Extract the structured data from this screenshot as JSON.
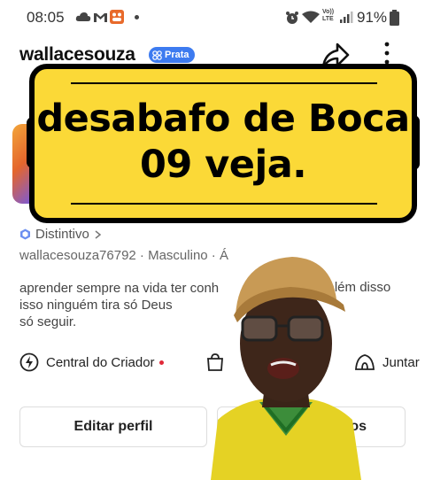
{
  "status_bar": {
    "time": "08:05",
    "battery": "91%",
    "left_icons": [
      "cloud-icon",
      "gmail-icon",
      "app-icon",
      "notification-dot"
    ],
    "right_icons": [
      "alarm-icon",
      "wifi-icon",
      "volte-icon",
      "signal-icon",
      "battery-icon"
    ]
  },
  "profile": {
    "username": "wallacesouza",
    "badge": "Prata",
    "distintivo": "Distintivo",
    "meta": "wallacesouza76792 · Masculino · Á",
    "bio": [
      "aprender sempre na vida ter conh",
      "isso ninguém tira só Deus",
      "só seguir."
    ],
    "bio_tail": "a além disso"
  },
  "overlay": {
    "line1": "desabafo de Boca",
    "line2": "09 veja.",
    "bg_color": "#fbd937"
  },
  "actions": {
    "creator_center": "Central do Criador",
    "shop_partial": "",
    "join_partial": "Juntar"
  },
  "buttons": {
    "edit_profile": "Editar perfil",
    "friends_partial": "igos"
  },
  "colors": {
    "accent": "#3d7bf0",
    "notification_dot": "#e02838"
  }
}
